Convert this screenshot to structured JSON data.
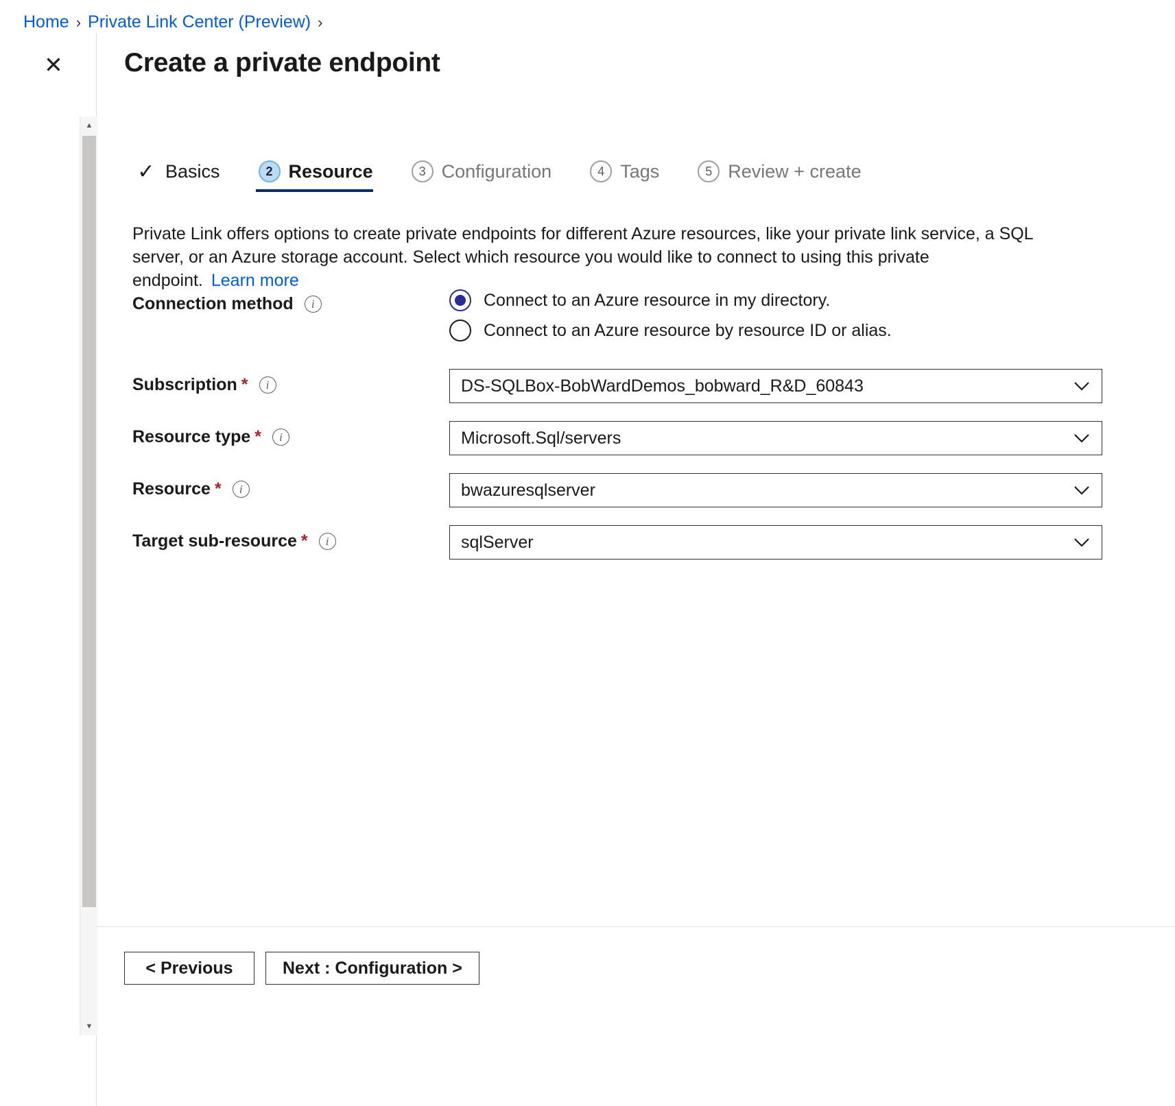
{
  "breadcrumb": {
    "items": [
      {
        "label": "Home"
      },
      {
        "label": "Private Link Center (Preview)"
      }
    ],
    "separator": "›"
  },
  "blade": {
    "close_icon": "✕",
    "title": "Create a private endpoint"
  },
  "scrollbar": {
    "up_arrow": "▲",
    "down_arrow": "▼"
  },
  "tabs": [
    {
      "marker": "✓",
      "label": "Basics",
      "state": "done"
    },
    {
      "marker": "2",
      "label": "Resource",
      "state": "active"
    },
    {
      "marker": "3",
      "label": "Configuration",
      "state": "pending"
    },
    {
      "marker": "4",
      "label": "Tags",
      "state": "pending"
    },
    {
      "marker": "5",
      "label": "Review + create",
      "state": "pending"
    }
  ],
  "description": {
    "text": "Private Link offers options to create private endpoints for different Azure resources, like your private link service, a SQL server, or an Azure storage account. Select which resource you would like to connect to using this private endpoint.",
    "link_label": "Learn more"
  },
  "form": {
    "connection_method": {
      "label": "Connection method",
      "options": [
        {
          "label": "Connect to an Azure resource in my directory.",
          "selected": true
        },
        {
          "label": "Connect to an Azure resource by resource ID or alias.",
          "selected": false
        }
      ]
    },
    "fields": [
      {
        "label": "Subscription",
        "required": "*",
        "value": "DS-SQLBox-BobWardDemos_bobward_R&D_60843"
      },
      {
        "label": "Resource type",
        "required": "*",
        "value": "Microsoft.Sql/servers"
      },
      {
        "label": "Resource",
        "required": "*",
        "value": "bwazuresqlserver"
      },
      {
        "label": "Target sub-resource",
        "required": "*",
        "value": "sqlServer"
      }
    ],
    "info_glyph": "i",
    "chevron_glyph": "⌄"
  },
  "footer": {
    "previous_label": "< Previous",
    "next_label": "Next : Configuration >"
  },
  "colors": {
    "link": "#015cda",
    "accent_tab_underline": "#002f6c",
    "active_step_bg": "#bcdcf4",
    "required_asterisk": "#a4262c",
    "radio_selected": "#2a2a9e"
  }
}
